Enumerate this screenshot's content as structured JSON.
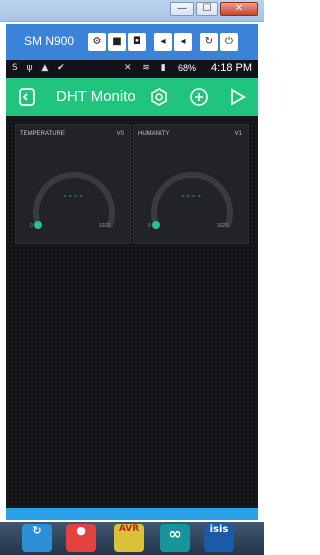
{
  "window": {
    "minimize_glyph": "—",
    "maximize_glyph": "☐",
    "close_glyph": "✕"
  },
  "emulator": {
    "title": "SM N900",
    "buttons": [
      {
        "icon": "gear-icon",
        "glyph": "⚙"
      },
      {
        "icon": "video-camera-icon",
        "glyph": "■"
      },
      {
        "icon": "camera-icon",
        "glyph": "◘"
      },
      {
        "icon": "volume-down-icon",
        "glyph": "◂"
      },
      {
        "icon": "volume-up-icon",
        "glyph": "◂"
      },
      {
        "icon": "rotate-icon",
        "glyph": "↻"
      },
      {
        "icon": "power-icon",
        "glyph": "⏻"
      }
    ]
  },
  "status_bar": {
    "left_icons": "S ψ ▲ ✔",
    "right_icons": "✕ ≋ ▮",
    "battery": "68%",
    "time": "4:18 PM"
  },
  "app_header": {
    "title": "DHT Monito",
    "icons": [
      "back-icon",
      "settings-hex-icon",
      "add-icon",
      "play-icon"
    ]
  },
  "gauges": [
    {
      "label": "TEMPERATURE",
      "pin": "V0",
      "value": "----",
      "min": "0",
      "max": "1023",
      "level": 0
    },
    {
      "label": "HUMANITY",
      "pin": "V1",
      "value": "----",
      "min": "0",
      "max": "1023",
      "level": 0
    }
  ],
  "colors": {
    "accent": "#23c48e",
    "header": "#20c47d",
    "emulator_toolbar": "#3b83d8",
    "nav_bar": "#2aa0e8"
  },
  "taskbar": {
    "apps": [
      {
        "name": "sync-app-icon",
        "glyph": "↻",
        "color": "#2d8fd6"
      },
      {
        "name": "ladybug-app-icon",
        "glyph": "●",
        "color": "#e44141"
      },
      {
        "name": "bascom-avr-app-icon",
        "glyph": "AVR",
        "color": "#d9c23a"
      },
      {
        "name": "arduino-app-icon",
        "glyph": "∞",
        "color": "#16959b"
      },
      {
        "name": "isis-app-icon",
        "glyph": "isis",
        "color": "#1b5aa6"
      }
    ]
  }
}
